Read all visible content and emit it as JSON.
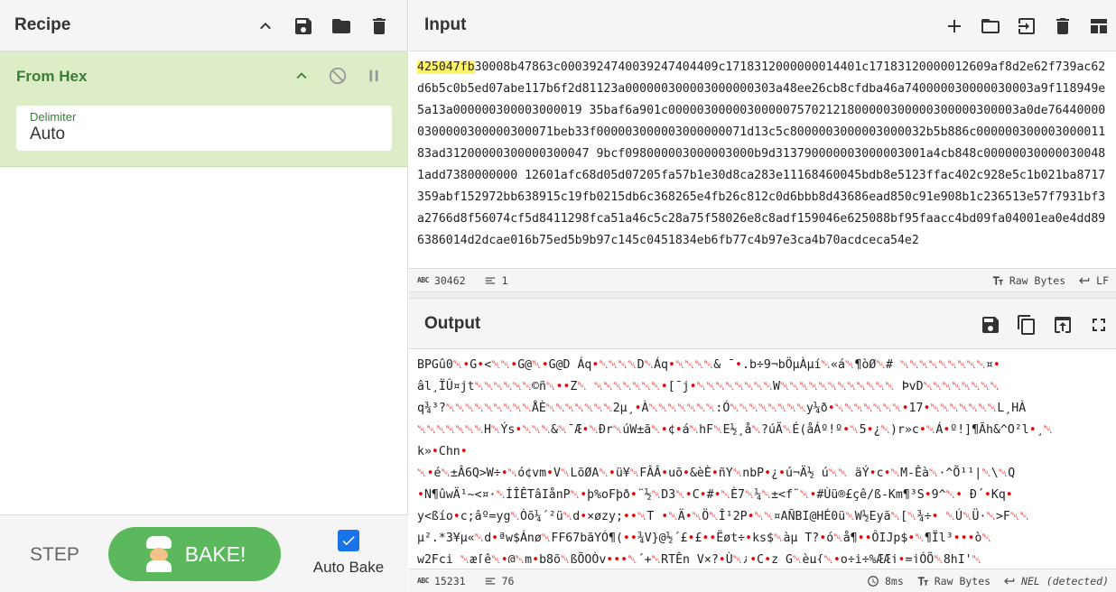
{
  "recipe": {
    "title": "Recipe",
    "operation": {
      "name": "From Hex",
      "delimiter_label": "Delimiter",
      "delimiter_value": "Auto"
    },
    "step_label": "STEP",
    "bake_label": "BAKE!",
    "auto_bake_label": "Auto Bake",
    "auto_bake_checked": true
  },
  "input": {
    "title": "Input",
    "highlight": "425047fb",
    "text": "30008b47863c0003924740039247404409c1718312000000014401c17183120000012609af8d2e62f739ac62d6b5c0b5ed07abe117b6f2d81123a000000300003000000303a48ee26cb8cfdba46a740000030000030003a9f118949e5a13a000000300003000019 35baf6a901c0000030000030000075702121800000300000300000300003a0de764400000300000300000300071beb33f000003000003000000071d13c5c8000003000003000032b5b886c000000300003000011 83ad31200000300000300047 9bcf098000003000003000b9d313790000003000003001a4cb848c000000300000300481add7380000000 12601afc68d05d07205fa57b1e30d8ca283e11168460045bdb8e5123ffac402c928e5c1b021ba8717359abf152972bb638915c19fb0215db6c368265e4fb26c812c0d6bbb8d43686ead850c91e908b1c236513e57f7931bf3a2766d8f56074cf5d8411298fca51a46c5c28a75f58026e8c8adf159046e625088bf95faacc4bd09fa04001ea0e4dd896386014d2dcae016b75ed5b9b97c145c0451834eb6fb77c4b97e3ca4b70acdceca54e2",
    "status": {
      "length": "30462",
      "lines": "1",
      "raw_bytes": "Raw Bytes",
      "eol": "LF"
    }
  },
  "output": {
    "title": "Output",
    "lines": [
      "BPGû0␀•G•<␀␀•G@␀•G@D    Áq•␀␀␀␀D␀Áq•␀␀␀␀& ¯•.b÷9¬bÖµÀµí␀«á␀¶òØ␀#  ␀␀␀␀␀␀␀␀␀¤•",
      "âl¸ÏÛ¤jt␀␀␀␀␀␀©ñ␀••Z␀ ␀␀␀␀␀␀␀•[¯j•␀␀␀␀␀␀␀␀W␀␀␀␀␀␀␀␀␀␀␀␀ ÞvD␀␀␀␀␀␀␀␀",
      "q¾³?␀␀␀␀␀␀␀␀␀ÅÈ␀␀␀␀␀␀␀2µ¸•À␀␀␀␀␀␀␀:Ó␀␀␀␀␀␀␀␀y¼ð•␀␀␀␀␀␀␀•17•␀␀␀␀␀␀␀L¸HÀ",
      "␀␀␀␀␀␀␀H␀Ýs•␀␀␀&␀¯Æ•␀Ðr␀úW±ã␀•¢•á␀hF␀E½¸å␀?úÄ␀É(åÁº!º•␀5•¿␀)r»c•␀Á•º!]¶Ãh&^O²l•¸␀",
      "k»•Chn•",
      "␀•é␀±Â6Q>W÷•␀ó¢vm•V␀LõØA␀•ü¥␀FÂÂ•uõ•&èÈ•ñY␀nbP•¿•ú¬Ä½   ú␀␀ äÝ•c•␀M-Êà␀·^Õ¹¹|␀\\␀Q",
      "•N¶ûwÄ¹~<¤·␀ÍÎÊTâIånP␀•þ%oFþð•¨½␀D3␀•C•#•␀È7␀¼␀±<f¨␀•#Ùü®£çê/ß-Km¶³S•9^␀• Ð´•Kq•",
      "y<ßío•c;âº=yg␀Òõ¼´²ü␀d•×øzy;••␀T •␀Ä•␀Ö␀Î¹2P•␀␀¤AÑBI@HÉ0ü␀W½Eyã␀[␀¾÷•   ␀Ú␀Ü·␀>F␀␀",
      "µ².*3¥µ«␀d•ªw$Ánø␀FF67bãYÓ¶(••¾V}@½´£•£••Ëøt÷•ks$␀àµ T?•ó␀å¶••ÔIJp$•␀¶Ïl³•••ò␀",
      "w2Fci ␀æ[ê␀•@␀m•þ8õ␀ßÕOÒv•••␀´+␀RTÊn_V×?•Ù␀¿•Ç•z¸G␀èµ{␀•o÷i÷%ÆÆj•=jÓÕ␀8hI'␀"
    ],
    "status": {
      "length": "15231",
      "lines": "76",
      "time": "8ms",
      "raw_bytes": "Raw Bytes",
      "eol": "NEL (detected)"
    }
  }
}
